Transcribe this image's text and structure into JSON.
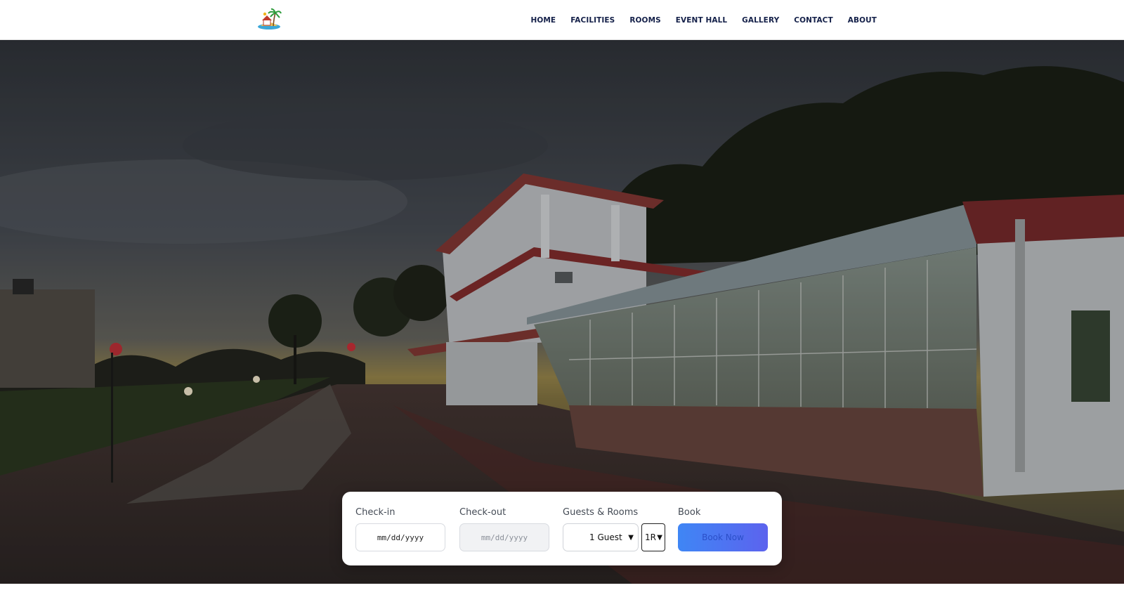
{
  "nav": {
    "items": [
      "HOME",
      "FACILITIES",
      "ROOMS",
      "EVENT HALL",
      "GALLERY",
      "CONTACT",
      "ABOUT"
    ]
  },
  "booking": {
    "checkin_label": "Check-in",
    "checkin_value": "mm/dd/yyyy",
    "checkout_label": "Check-out",
    "checkout_value": "mm/dd/yyyy",
    "guests_label": "Guests & Rooms",
    "guests_value": "1 Guest",
    "rooms_value": "1R",
    "book_label": "Book",
    "book_button": "Book Now"
  },
  "colors": {
    "nav_text": "#142049",
    "button_start": "#3f86f5",
    "button_end": "#5c63ee"
  },
  "icons": {
    "logo": "resort-palm-logo",
    "select_arrow": "chevron-down-icon"
  }
}
